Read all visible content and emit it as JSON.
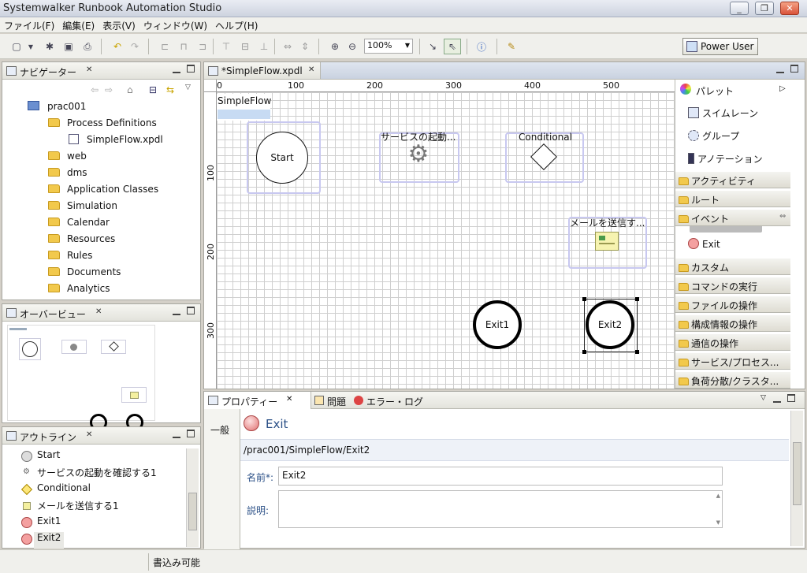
{
  "window": {
    "title": "Systemwalker Runbook Automation Studio",
    "minimize_icon": "minimize-icon",
    "maximize_icon": "restore-icon",
    "close_icon": "close-icon"
  },
  "menu": {
    "items": [
      "ファイル(F)",
      "編集(E)",
      "表示(V)",
      "ウィンドウ(W)",
      "ヘルプ(H)"
    ]
  },
  "toolbar": {
    "zoom": "100%",
    "perspective": "Power User"
  },
  "navigator": {
    "title": "ナビゲーター",
    "project": "prac001",
    "items": [
      {
        "label": "Process Definitions",
        "level": 1,
        "type": "folder"
      },
      {
        "label": "SimpleFlow.xpdl",
        "level": 2,
        "type": "file"
      },
      {
        "label": "web",
        "level": 1,
        "type": "folder"
      },
      {
        "label": "dms",
        "level": 1,
        "type": "folder"
      },
      {
        "label": "Application Classes",
        "level": 1,
        "type": "folder"
      },
      {
        "label": "Simulation",
        "level": 1,
        "type": "folder"
      },
      {
        "label": "Calendar",
        "level": 1,
        "type": "folder"
      },
      {
        "label": "Resources",
        "level": 1,
        "type": "folder"
      },
      {
        "label": "Rules",
        "level": 1,
        "type": "folder"
      },
      {
        "label": "Documents",
        "level": 1,
        "type": "folder"
      },
      {
        "label": "Analytics",
        "level": 1,
        "type": "folder"
      }
    ]
  },
  "overview": {
    "title": "オーバービュー"
  },
  "outline": {
    "title": "アウトライン",
    "items": [
      {
        "label": "Start",
        "icon": "start-circle-icon"
      },
      {
        "label": "サービスの起動を確認する1",
        "icon": "gear-icon"
      },
      {
        "label": "Conditional",
        "icon": "diamond-icon"
      },
      {
        "label": "メールを送信する1",
        "icon": "mail-icon"
      },
      {
        "label": "Exit1",
        "icon": "exit-circle-icon"
      },
      {
        "label": "Exit2",
        "icon": "exit-circle-icon"
      }
    ]
  },
  "editor": {
    "tab": "*SimpleFlow.xpdl",
    "pool_label": "SimpleFlow",
    "ruler_h": [
      "0",
      "100",
      "200",
      "300",
      "400",
      "500"
    ],
    "ruler_v": [
      "100",
      "200",
      "300"
    ],
    "nodes": {
      "start": "Start",
      "service": "サービスの起動...",
      "conditional": "Conditional",
      "mail": "メールを送信す...",
      "exit1": "Exit1",
      "exit2": "Exit2"
    }
  },
  "palette": {
    "title": "パレット",
    "tools": [
      "スイムレーン",
      "グループ",
      "アノテーション"
    ],
    "drawers_top": [
      "アクティビティ",
      "ルート",
      "イベント"
    ],
    "event_items": [
      "Exit"
    ],
    "drawers_bottom": [
      "カスタム",
      "コマンドの実行",
      "ファイルの操作",
      "構成情報の操作",
      "通信の操作",
      "サービス/プロセス...",
      "負荷分散/クラスタ..."
    ]
  },
  "properties": {
    "tabs": [
      "プロパティー",
      "問題",
      "エラー・ログ"
    ],
    "section": "一般",
    "element_type": "Exit",
    "path": "/prac001/SimpleFlow/Exit2",
    "name_label": "名前*:",
    "name_value": "Exit2",
    "desc_label": "説明:",
    "desc_value": ""
  },
  "status": {
    "text": "書込み可能"
  }
}
